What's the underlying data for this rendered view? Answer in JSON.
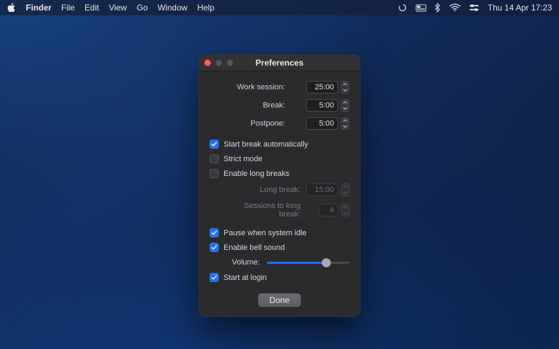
{
  "menubar": {
    "app_name": "Finder",
    "items": [
      "File",
      "Edit",
      "View",
      "Go",
      "Window",
      "Help"
    ],
    "clock": "Thu 14 Apr  17:23"
  },
  "window": {
    "title": "Preferences",
    "labels": {
      "work_session": "Work session:",
      "break": "Break:",
      "postpone": "Postpone:",
      "long_break": "Long break:",
      "sessions_to_long_break": "Sessions to long break:",
      "volume": "Volume:"
    },
    "values": {
      "work_session": "25:00",
      "break": "5:00",
      "postpone": "5:00",
      "long_break": "15:00",
      "sessions_to_long_break": "4"
    },
    "checkboxes": {
      "start_break_auto": {
        "label": "Start break automatically",
        "checked": true
      },
      "strict_mode": {
        "label": "Strict mode",
        "checked": false
      },
      "enable_long_breaks": {
        "label": "Enable long breaks",
        "checked": false
      },
      "pause_when_idle": {
        "label": "Pause when system idle",
        "checked": true
      },
      "enable_bell": {
        "label": "Enable bell sound",
        "checked": true
      },
      "start_at_login": {
        "label": "Start at login",
        "checked": true
      }
    },
    "volume_percent": 72,
    "done_label": "Done"
  },
  "colors": {
    "accent": "#1a73ff"
  }
}
